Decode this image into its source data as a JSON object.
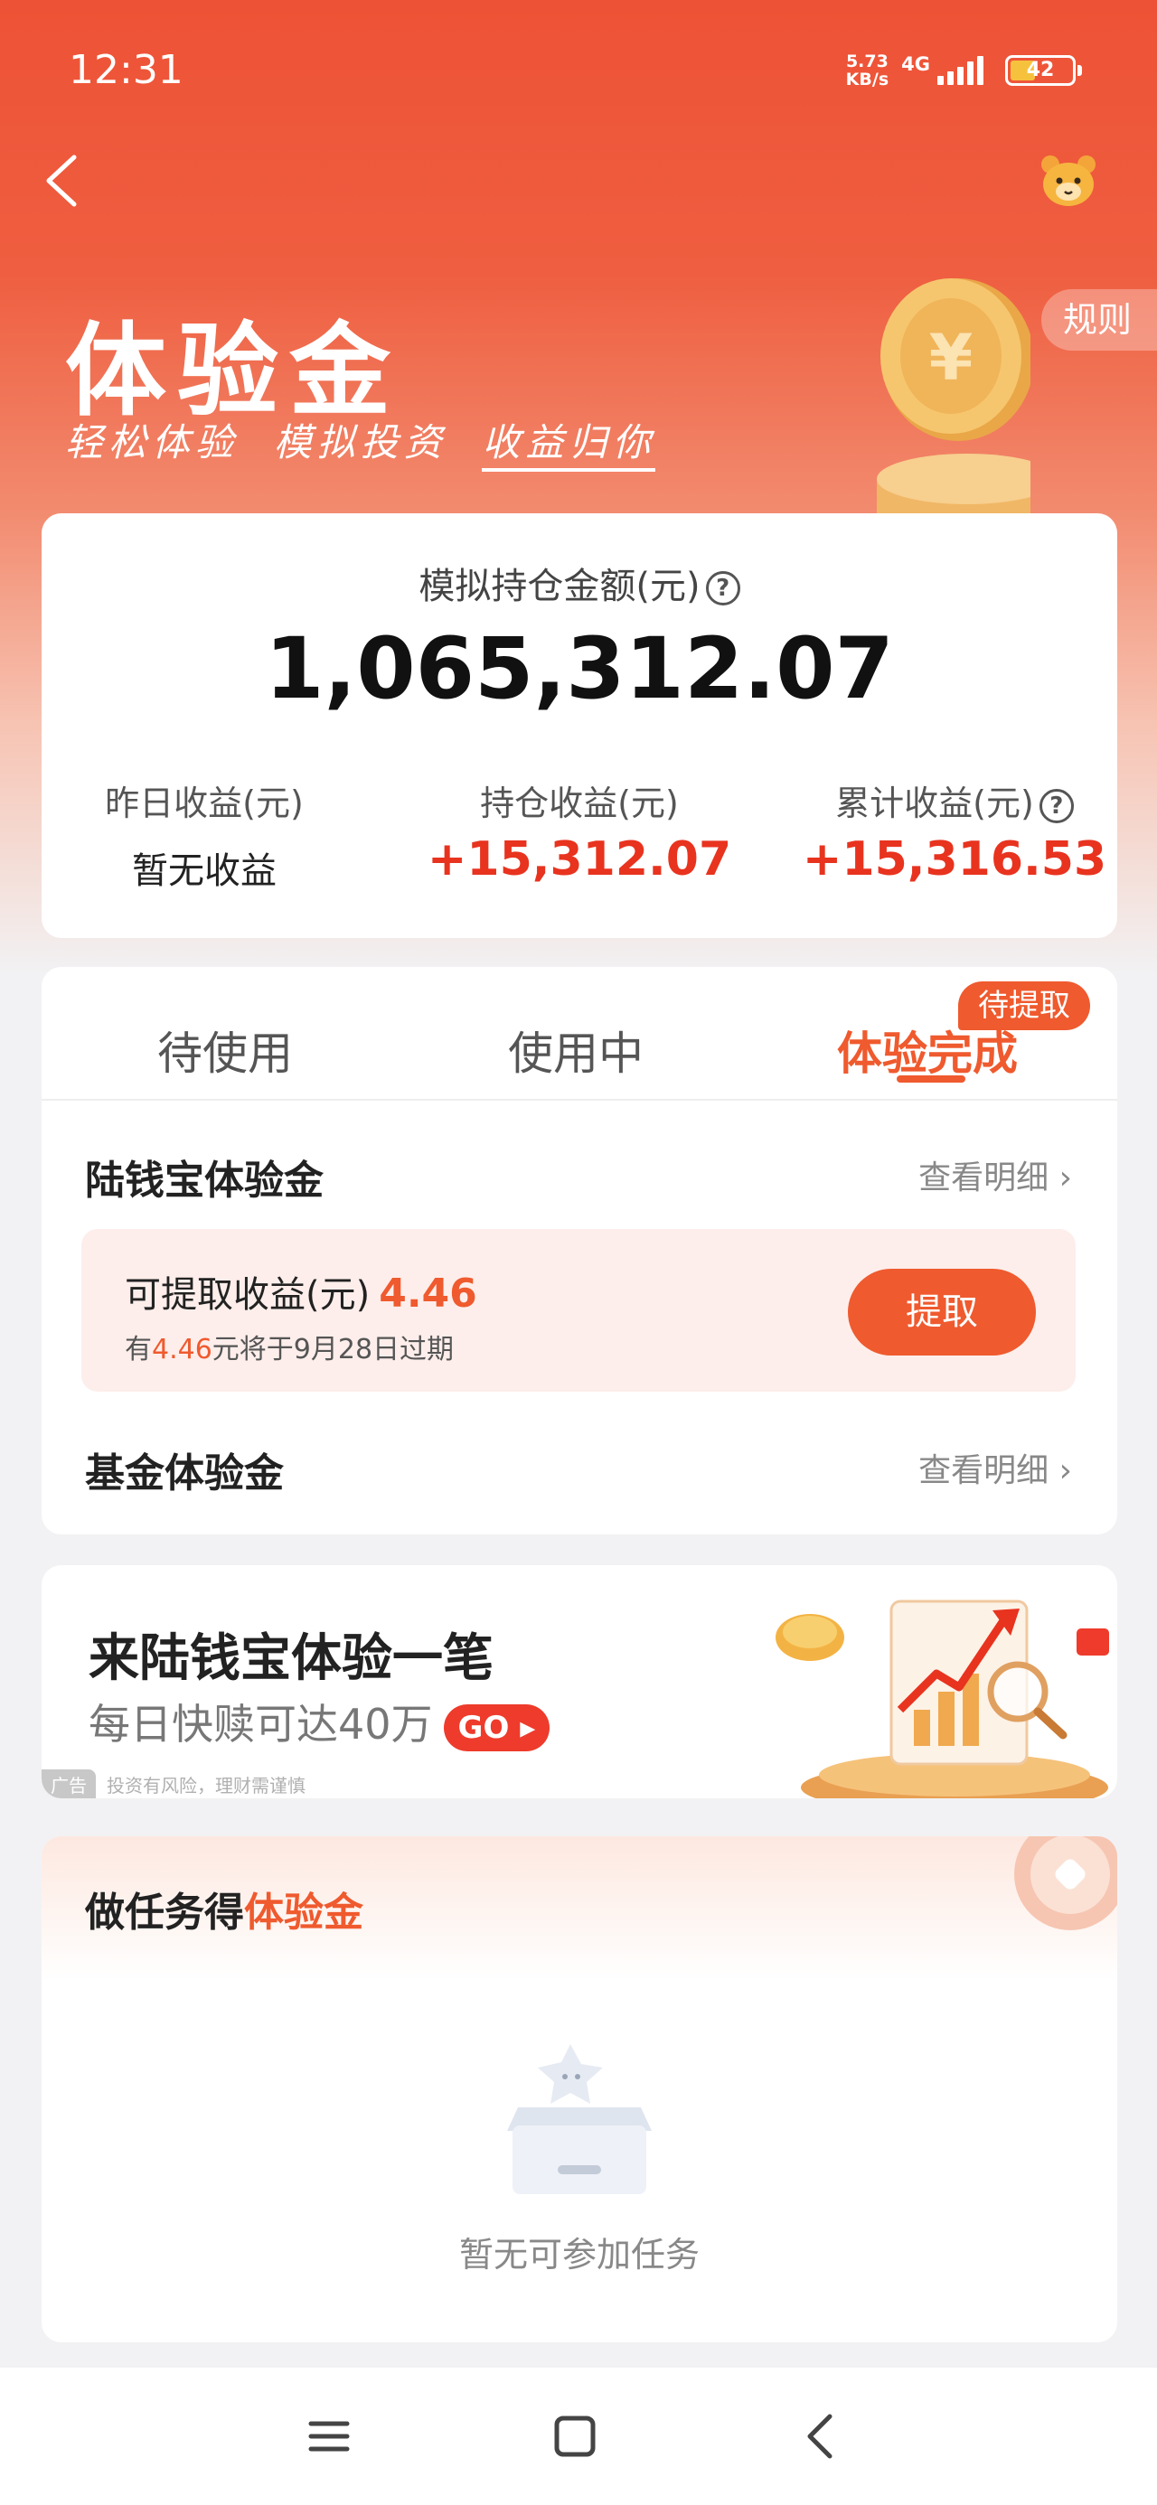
{
  "status_bar": {
    "time": "12:31",
    "net_speed_value": "5.73",
    "net_speed_unit": "KB/s",
    "net_type": "4G",
    "battery": "42"
  },
  "header": {
    "back_icon": "chevron-left-icon",
    "mascot_icon": "bear-mascot-icon",
    "title": "体验金",
    "slogan_part1": "轻松体验",
    "slogan_part2": "模拟投资",
    "slogan_part3": "收益归你",
    "rules_label": "规则"
  },
  "summary": {
    "holding_label": "模拟持仓金额(元)",
    "holding_value": "1,065,312.07",
    "yesterday_label": "昨日收益(元)",
    "yesterday_value": "暂无收益",
    "position_label": "持仓收益(元)",
    "position_value": "+15,312.07",
    "cumulative_label": "累计收益(元)",
    "cumulative_value": "+15,316.53"
  },
  "tabs": {
    "items": [
      "待使用",
      "使用中",
      "体验完成"
    ],
    "active": "体验完成",
    "badge": "待提取"
  },
  "lujinbao": {
    "title": "陆钱宝体验金",
    "detail_link": "查看明细",
    "withdraw_label": "可提取收益(元)",
    "withdraw_amount": "4.46",
    "note_prefix": "有",
    "note_amount": "4.46",
    "note_suffix": "元将于9月28日过期",
    "withdraw_button": "提取"
  },
  "fund": {
    "title": "基金体验金",
    "detail_link": "查看明细"
  },
  "ad": {
    "title": "来陆钱宝体验一笔",
    "subtitle": "每日快赎可达40万",
    "go_label": "GO",
    "tag": "广告",
    "disclaimer": "投资有风险，理财需谨慎"
  },
  "tasks": {
    "title_prefix": "做任务得",
    "title_highlight": "体验金",
    "empty_text": "暂无可参加任务"
  },
  "nav_bar": {
    "menu_icon": "menu-icon",
    "home_icon": "home-square-icon",
    "back_icon": "back-chevron-icon"
  },
  "colors": {
    "brand": "#ef5a2e",
    "gain_red": "#e8331f",
    "header_red": "#ee5236"
  }
}
